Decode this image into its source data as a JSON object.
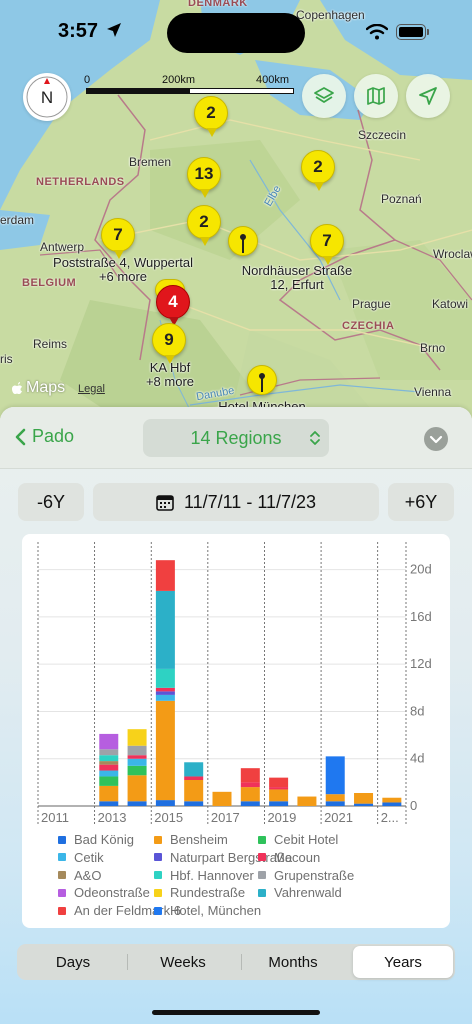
{
  "status": {
    "time": "3:57"
  },
  "map": {
    "scale_labels": [
      "0",
      "200km",
      "400km"
    ],
    "compass_label": "N",
    "apple_maps": "Maps",
    "legal": "Legal",
    "cities": [
      {
        "name": "Copenhagen"
      },
      {
        "name": "Szczecin"
      },
      {
        "name": "Bremen"
      },
      {
        "name": "Poznań"
      },
      {
        "name": "Antwerp"
      },
      {
        "name": "Wroclaw"
      },
      {
        "name": "Prague"
      },
      {
        "name": "Katowi"
      },
      {
        "name": "Reims"
      },
      {
        "name": "Brno"
      },
      {
        "name": "Vienna"
      },
      {
        "name": "erdam"
      },
      {
        "name": "ris"
      }
    ],
    "countries": [
      "DENMARK",
      "NETHERLANDS",
      "BELGIUM",
      "CZECHIA"
    ],
    "rivers": [
      "Elbe",
      "Danube"
    ],
    "clusters": [
      {
        "count": "2"
      },
      {
        "count": "13"
      },
      {
        "count": "2"
      },
      {
        "count": "2"
      },
      {
        "count": "7"
      },
      {
        "count": "7"
      },
      {
        "count": "4"
      },
      {
        "count": "9"
      }
    ],
    "marker_labels": [
      {
        "line1": "Poststraße 4, Wuppertal",
        "line2": "+6 more"
      },
      {
        "line1": "Nordhäuser Straße",
        "line2": "12, Erfurt"
      },
      {
        "line1": "KA  Hbf",
        "line2": "+8 more"
      },
      {
        "line1": "Hotel München",
        "line2": ""
      }
    ]
  },
  "sheet": {
    "back_label": "Pado",
    "regions_label": "14 Regions",
    "minus_label": "-6Y",
    "plus_label": "+6Y",
    "date_range": "11/7/11 - 11/7/23",
    "segments": [
      "Days",
      "Weeks",
      "Months",
      "Years"
    ],
    "selected_segment": "Years"
  },
  "colors": {
    "accent": "#3aa54a",
    "red_pin": "#e0161c",
    "yellow_pin": "#f6e600"
  },
  "chart_data": {
    "type": "bar",
    "stacked": true,
    "categories": [
      "2011",
      "2012",
      "2013",
      "2014",
      "2015",
      "2016",
      "2017",
      "2018",
      "2019",
      "2020",
      "2021",
      "2022",
      "2023"
    ],
    "x_tick_labels": [
      "2011",
      "2013",
      "2015",
      "2017",
      "2019",
      "2021",
      "2..."
    ],
    "y_tick_labels": [
      "0",
      "4d",
      "8d",
      "12d",
      "16d",
      "20d"
    ],
    "ylim": [
      0,
      22
    ],
    "y_unit": "d",
    "grid": true,
    "legend_position": "bottom",
    "series": [
      {
        "name": "Bad König",
        "color": "#1f6fe0",
        "values": [
          0,
          0,
          0.4,
          0.4,
          0.5,
          0.4,
          0,
          0.4,
          0.4,
          0,
          0.4,
          0.2,
          0.3
        ]
      },
      {
        "name": "Bensheim",
        "color": "#f39b16",
        "values": [
          0,
          0,
          1.3,
          2.2,
          8.4,
          1.8,
          1.2,
          1.2,
          1.0,
          0.8,
          0.6,
          0.9,
          0.4
        ]
      },
      {
        "name": "Cebit Hotel",
        "color": "#2fc25b",
        "values": [
          0,
          0,
          0.8,
          0.8,
          0,
          0,
          0,
          0,
          0,
          0,
          0,
          0,
          0
        ]
      },
      {
        "name": "Cetik",
        "color": "#3bb6e8",
        "values": [
          0,
          0,
          0.5,
          0.6,
          0.5,
          0,
          0,
          0,
          0,
          0,
          0,
          0,
          0
        ]
      },
      {
        "name": "Naturpart Bergstraße",
        "color": "#5a55d6",
        "values": [
          0,
          0,
          0,
          0,
          0.3,
          0,
          0,
          0,
          0,
          0,
          0,
          0,
          0
        ]
      },
      {
        "name": "Macoun",
        "color": "#f0325a",
        "values": [
          0,
          0,
          0.5,
          0.3,
          0.3,
          0.3,
          0,
          0.4,
          0.2,
          0,
          0,
          0,
          0
        ]
      },
      {
        "name": "A&O",
        "color": "#a58a5c",
        "values": [
          0,
          0,
          0.3,
          0,
          0,
          0,
          0,
          0,
          0,
          0,
          0,
          0,
          0
        ]
      },
      {
        "name": "Hbf. Hannover",
        "color": "#2ed2c3",
        "values": [
          0,
          0,
          0.5,
          0,
          1.6,
          0,
          0,
          0,
          0,
          0,
          0,
          0,
          0
        ]
      },
      {
        "name": "Grupenstraße",
        "color": "#9ea2a8",
        "values": [
          0,
          0,
          0.5,
          0.8,
          0,
          0,
          0,
          0,
          0,
          0,
          0,
          0,
          0
        ]
      },
      {
        "name": "Odeonstraße",
        "color": "#b65ee0",
        "values": [
          0,
          0,
          1.3,
          0,
          0,
          0,
          0,
          0,
          0,
          0,
          0,
          0,
          0
        ]
      },
      {
        "name": "Rundestraße",
        "color": "#f7d21a",
        "values": [
          0,
          0,
          0,
          1.4,
          0,
          0,
          0,
          0,
          0,
          0,
          0,
          0,
          0
        ]
      },
      {
        "name": "Vahrenwald",
        "color": "#2cb0c8",
        "values": [
          0,
          0,
          0,
          0,
          6.6,
          1.2,
          0,
          0,
          0,
          0,
          0,
          0,
          0
        ]
      },
      {
        "name": "An der Feldmark 6",
        "color": "#f04040",
        "values": [
          0,
          0,
          0,
          0,
          2.6,
          0,
          0,
          1.2,
          0.8,
          0,
          0,
          0,
          0
        ]
      },
      {
        "name": "Hotel, München",
        "color": "#1f78f0",
        "values": [
          0,
          0,
          0,
          0,
          0,
          0,
          0,
          0,
          0,
          0,
          3.2,
          0,
          0
        ]
      }
    ]
  }
}
